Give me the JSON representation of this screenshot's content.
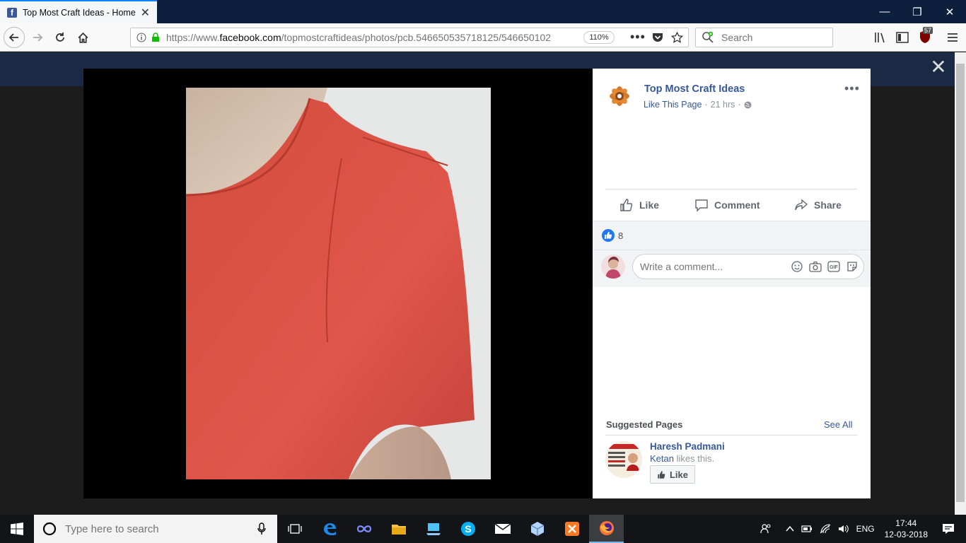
{
  "browser": {
    "tab_title": "Top Most Craft Ideas - Home",
    "url_prefix": "https://www.",
    "url_domain": "facebook.com",
    "url_path": "/topmostcraftideas/photos/pcb.546650535718125/546650102",
    "zoom": "110%",
    "search_placeholder": "Search",
    "ublock_badge": "57"
  },
  "post": {
    "page_name": "Top Most Craft Ideas",
    "like_page": "Like This Page",
    "time": "21 hrs",
    "separator": "·",
    "actions": {
      "like": "Like",
      "comment": "Comment",
      "share": "Share"
    },
    "reaction_count": "8",
    "comment_placeholder": "Write a comment..."
  },
  "suggested": {
    "title": "Suggested Pages",
    "see_all": "See All",
    "page_name": "Haresh Padmani",
    "friend": "Ketan",
    "likes_text": " likes this.",
    "like_button": "Like"
  },
  "taskbar": {
    "search_placeholder": "Type here to search",
    "language": "ENG",
    "time": "17:44",
    "date": "12-03-2018"
  }
}
